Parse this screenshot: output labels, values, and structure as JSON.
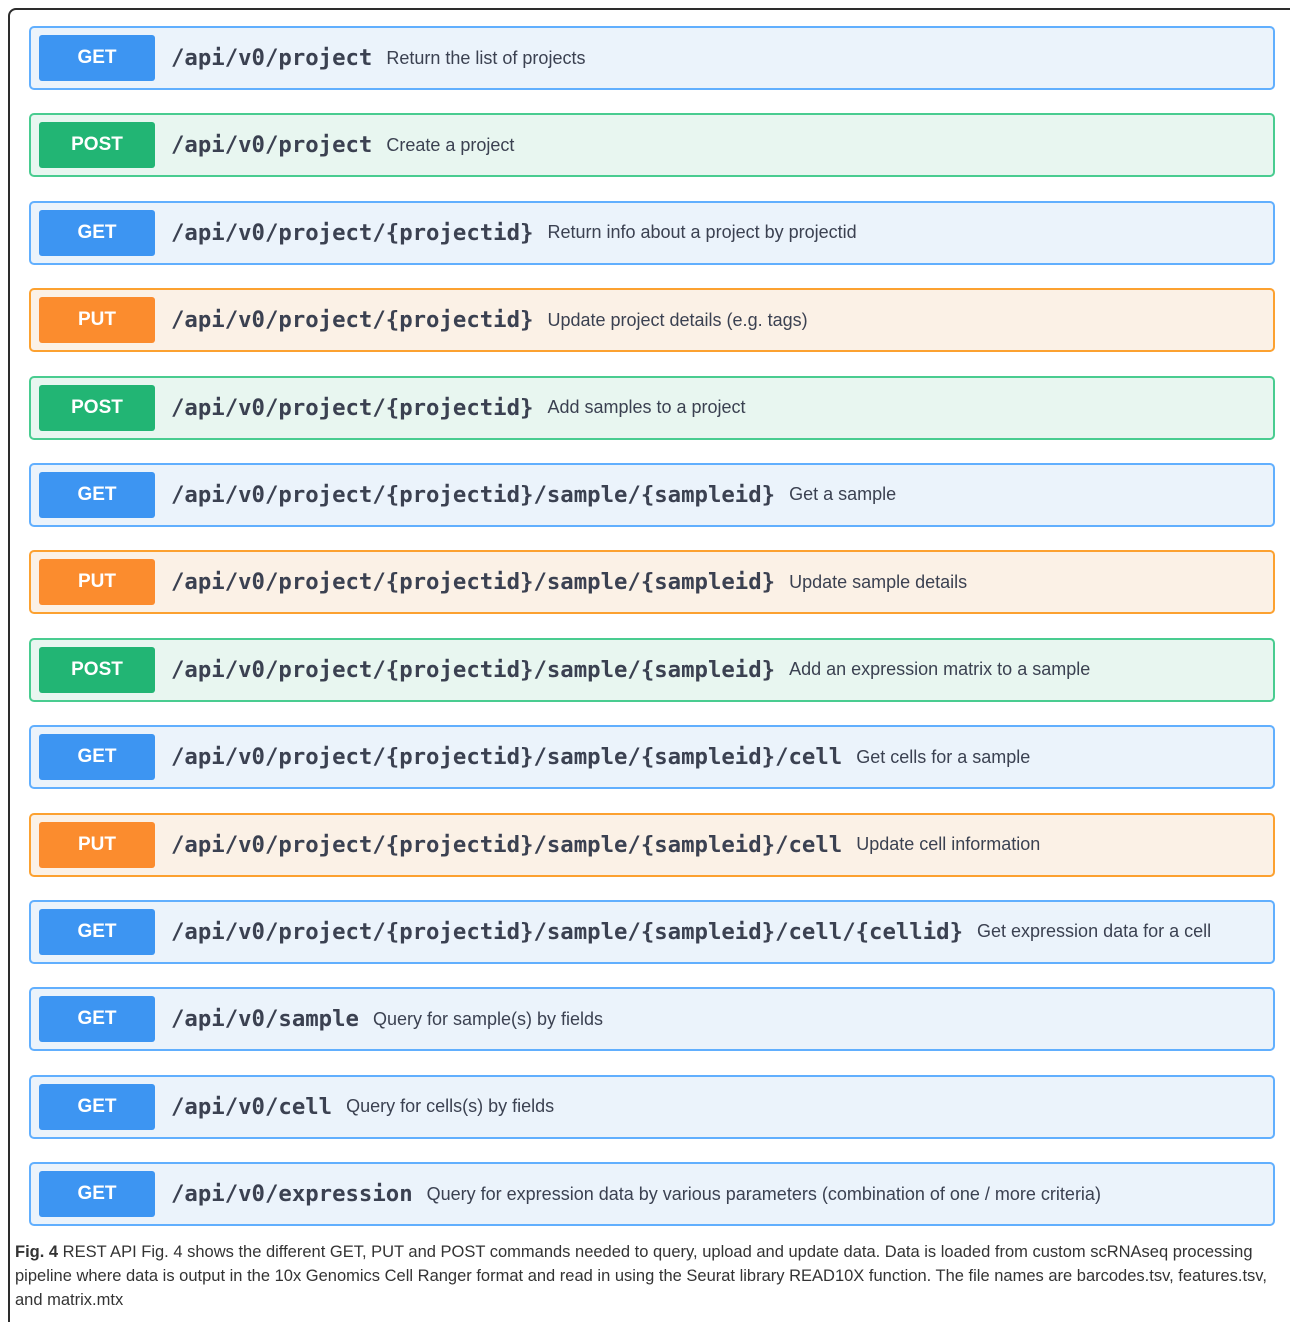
{
  "operations": [
    {
      "method": "GET",
      "path": "/api/v0/project",
      "summary": "Return the list of projects"
    },
    {
      "method": "POST",
      "path": "/api/v0/project",
      "summary": "Create a project"
    },
    {
      "method": "GET",
      "path": "/api/v0/project/{projectid}",
      "summary": "Return info about a project by projectid"
    },
    {
      "method": "PUT",
      "path": "/api/v0/project/{projectid}",
      "summary": "Update project details (e.g. tags)"
    },
    {
      "method": "POST",
      "path": "/api/v0/project/{projectid}",
      "summary": "Add samples to a project"
    },
    {
      "method": "GET",
      "path": "/api/v0/project/{projectid}/sample/{sampleid}",
      "summary": "Get a sample"
    },
    {
      "method": "PUT",
      "path": "/api/v0/project/{projectid}/sample/{sampleid}",
      "summary": "Update sample details"
    },
    {
      "method": "POST",
      "path": "/api/v0/project/{projectid}/sample/{sampleid}",
      "summary": "Add an expression matrix to a sample"
    },
    {
      "method": "GET",
      "path": "/api/v0/project/{projectid}/sample/{sampleid}/cell",
      "summary": "Get cells for a sample"
    },
    {
      "method": "PUT",
      "path": "/api/v0/project/{projectid}/sample/{sampleid}/cell",
      "summary": "Update cell information"
    },
    {
      "method": "GET",
      "path": "/api/v0/project/{projectid}/sample/{sampleid}/cell/{cellid}",
      "summary": "Get expression data for a cell"
    },
    {
      "method": "GET",
      "path": "/api/v0/sample",
      "summary": "Query for sample(s) by fields"
    },
    {
      "method": "GET",
      "path": "/api/v0/cell",
      "summary": "Query for cells(s) by fields"
    },
    {
      "method": "GET",
      "path": "/api/v0/expression",
      "summary": "Query for expression data by various parameters (combination of one / more criteria)"
    }
  ],
  "caption": {
    "label": "Fig. 4",
    "text": " REST API Fig. 4 shows the different GET, PUT and POST commands needed to query, upload and update data. Data is loaded from custom scRNAseq processing pipeline where data is output in the 10x Genomics Cell Ranger format and read in using the Seurat library READ10X function. The file names are barcodes.tsv, features.tsv, and matrix.mtx"
  },
  "colors": {
    "get": "#61affe",
    "post": "#49cc90",
    "put": "#fca130"
  }
}
